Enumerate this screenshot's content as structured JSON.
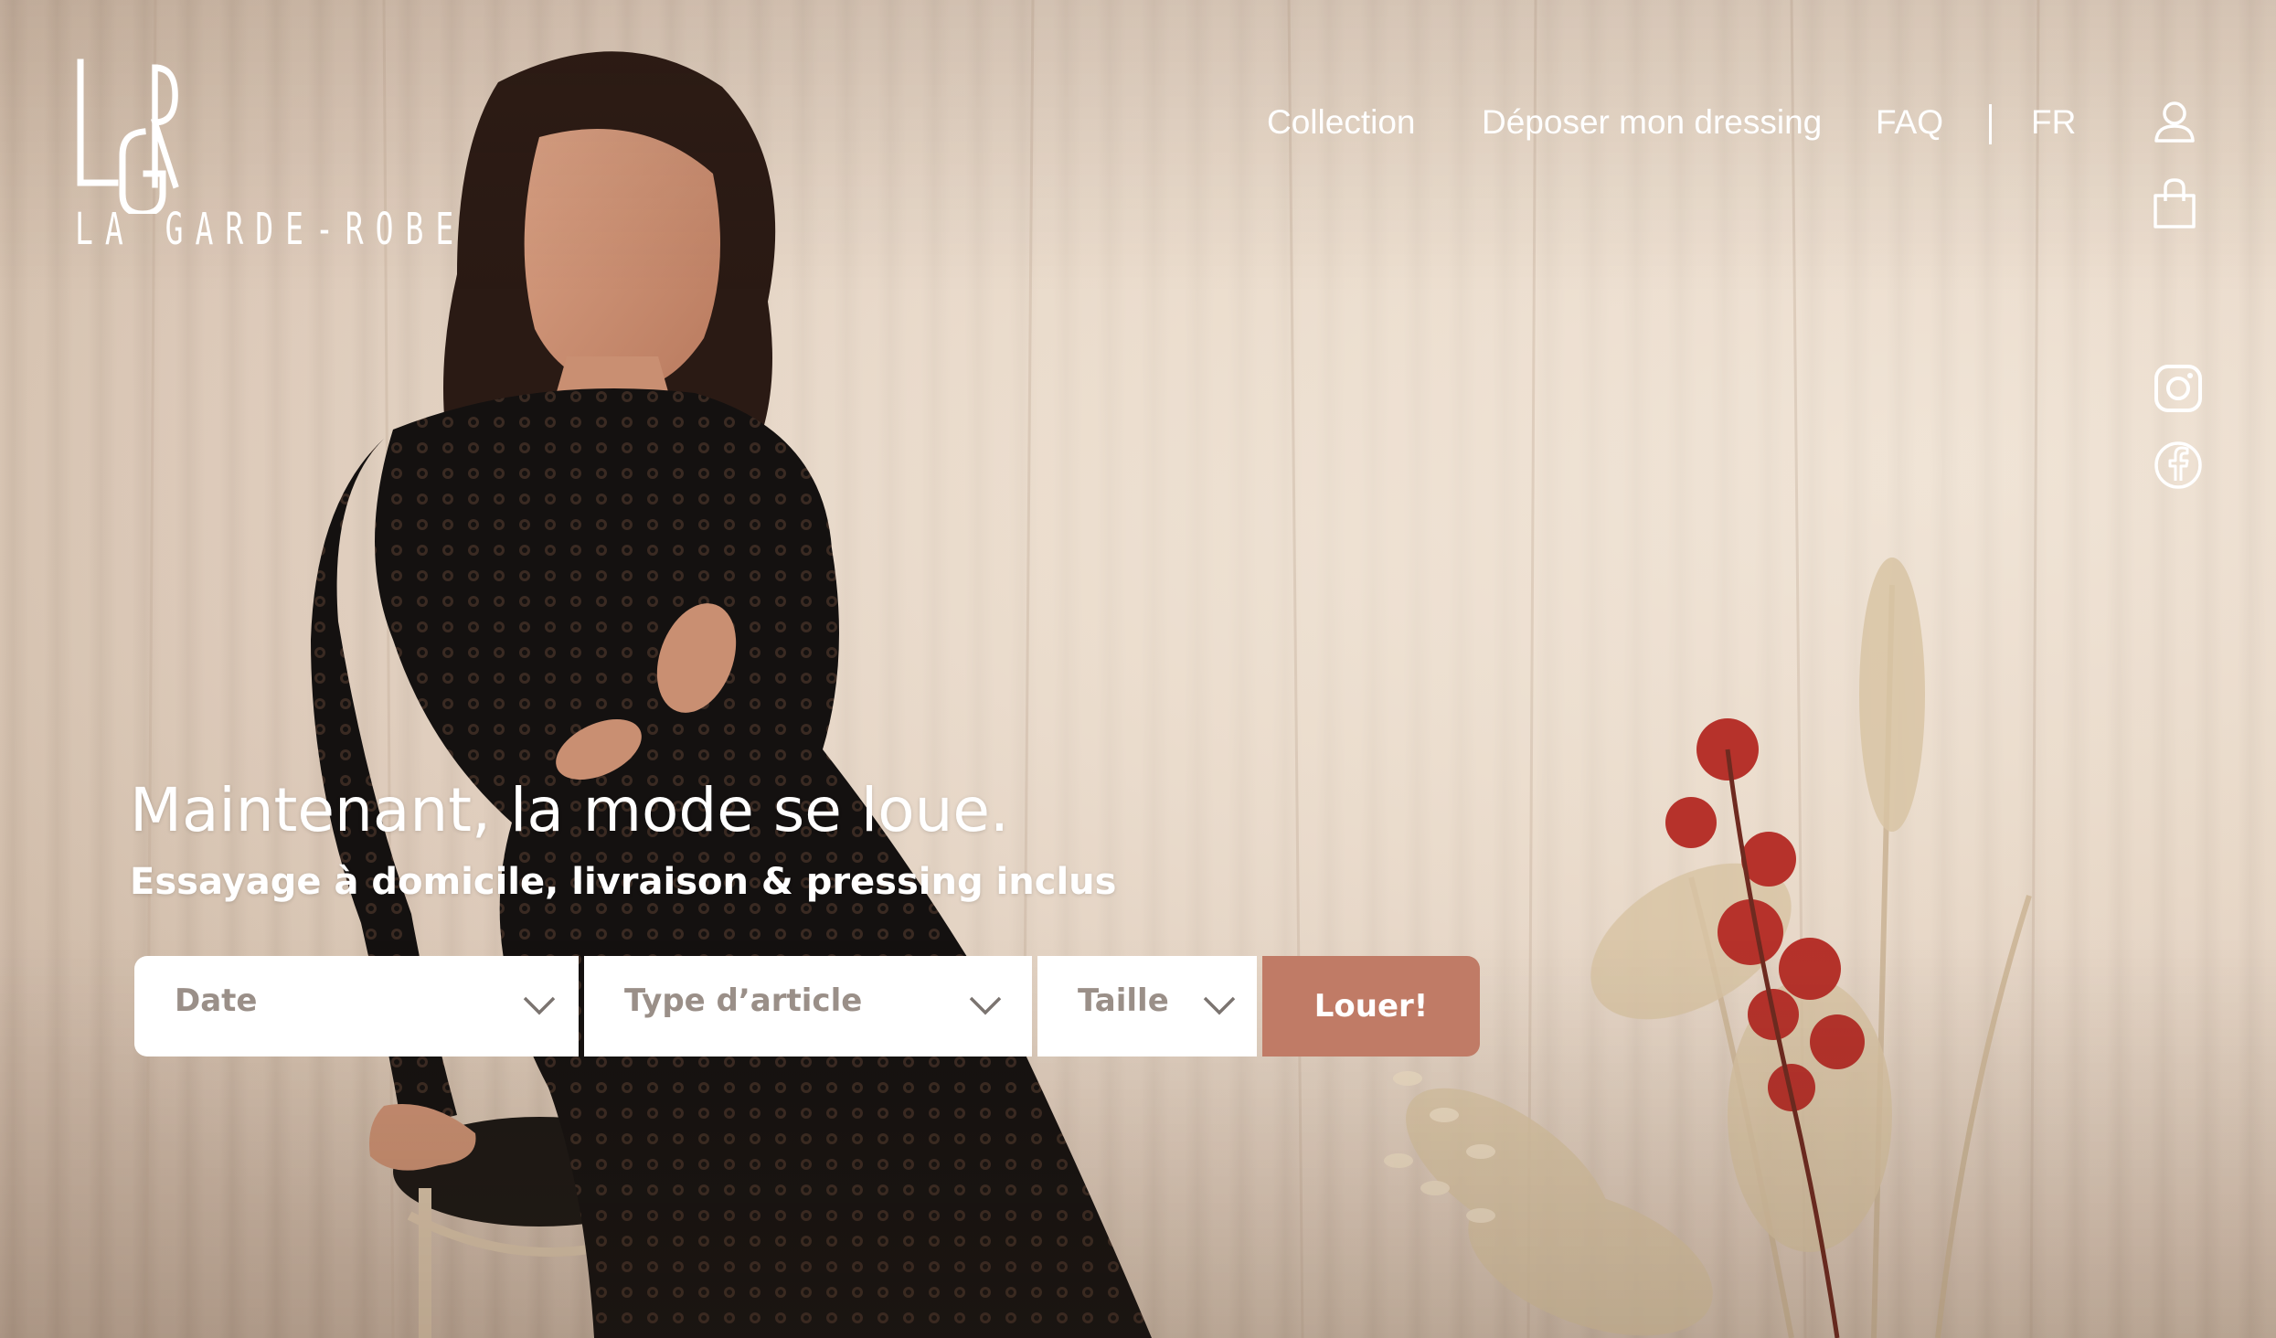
{
  "brand": {
    "logo_letters": "LGR",
    "logo_subtitle": "LA GARDE-ROBE"
  },
  "nav": {
    "items": [
      {
        "label": "Collection"
      },
      {
        "label": "Déposer mon dressing"
      },
      {
        "label": "FAQ"
      }
    ],
    "language": "FR"
  },
  "icons": {
    "account": "user-icon",
    "cart": "shopping-bag-icon",
    "instagram": "instagram-icon",
    "facebook": "facebook-icon"
  },
  "hero": {
    "headline": "Maintenant, la mode se loue.",
    "subheadline": "Essayage à domicile, livraison & pressing inclus"
  },
  "search": {
    "date_label": "Date",
    "type_label": "Type d’article",
    "size_label": "Taille",
    "submit_label": "Louer!"
  },
  "colors": {
    "accent": "#c07b66",
    "background": "#e4d2c1",
    "text_on_image": "#ffffff"
  }
}
